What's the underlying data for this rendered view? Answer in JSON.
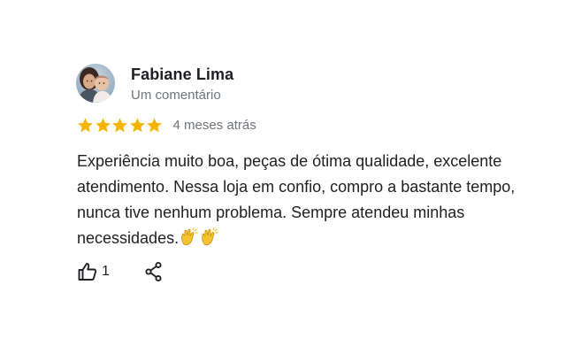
{
  "review": {
    "author": {
      "name": "Fabiane Lima",
      "meta": "Um comentário",
      "avatar": "profile-photo"
    },
    "rating": {
      "stars": 5,
      "max_stars": 5,
      "star_color": "#f4b400",
      "date": "4 meses atrás"
    },
    "text": "Experiência muito boa, peças de ótima qualidade, excelente atendimento. Nessa loja em confio, compro a bastante tempo, nunca tive nenhum problema. Sempre atendeu minhas necessidades.",
    "emoji": [
      "clapping-hands-icon",
      "clapping-hands-icon"
    ],
    "actions": {
      "like_icon": "thumbs-up-icon",
      "like_count": "1",
      "share_icon": "share-icon"
    }
  },
  "colors": {
    "text_primary": "#202124",
    "text_secondary": "#70757a",
    "background": "#ffffff"
  }
}
